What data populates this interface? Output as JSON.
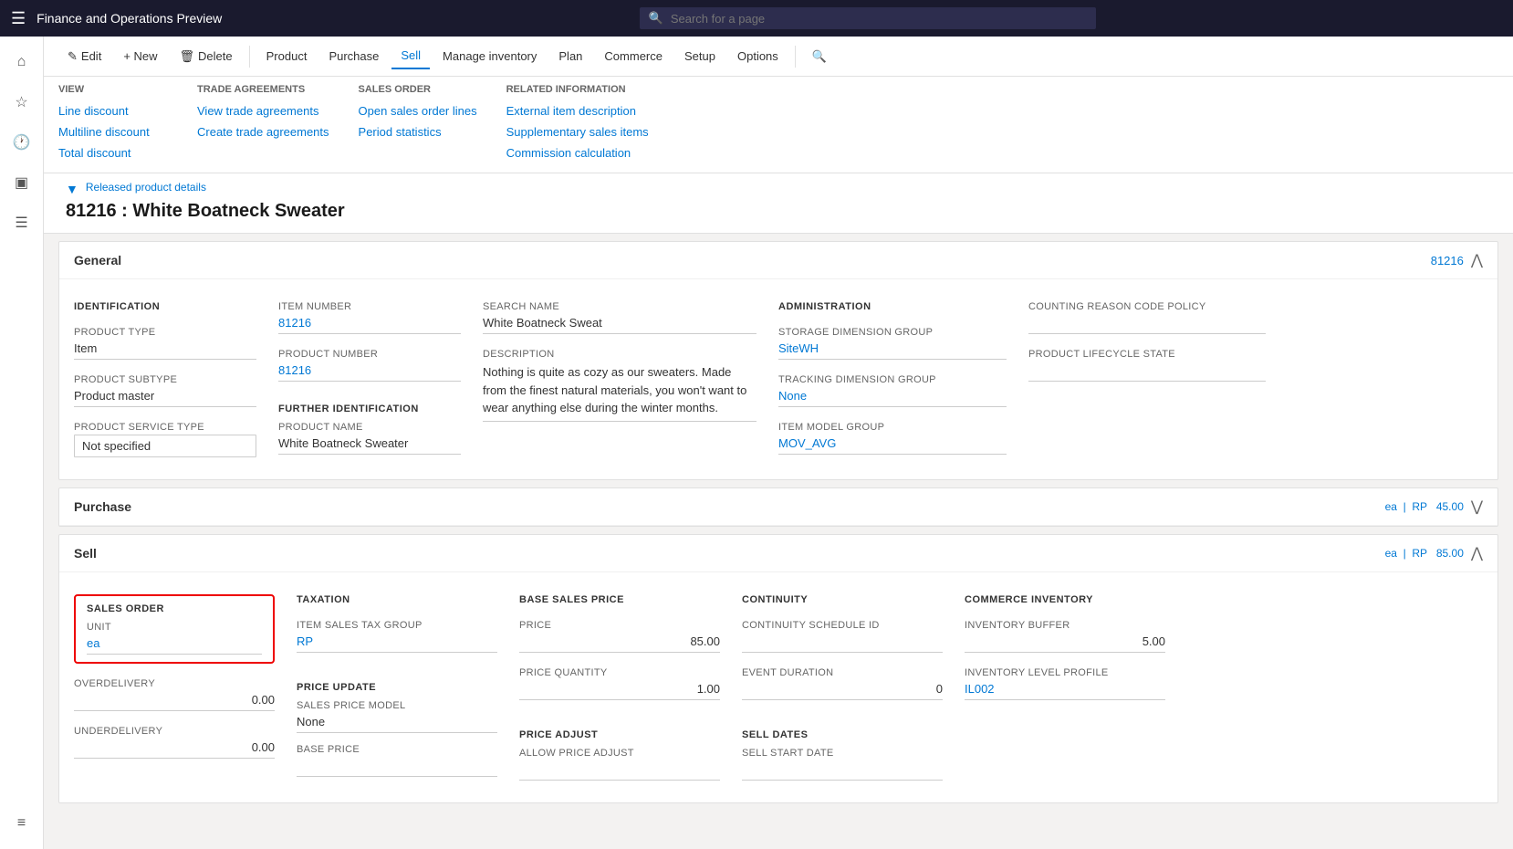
{
  "app": {
    "title": "Finance and Operations Preview",
    "search_placeholder": "Search for a page"
  },
  "sidebar": {
    "icons": [
      {
        "name": "home-icon",
        "symbol": "⌂"
      },
      {
        "name": "star-icon",
        "symbol": "☆"
      },
      {
        "name": "clock-icon",
        "symbol": "🕐"
      },
      {
        "name": "grid-icon",
        "symbol": "⊞"
      },
      {
        "name": "list-icon",
        "symbol": "☰"
      },
      {
        "name": "menu-icon",
        "symbol": "≡"
      }
    ]
  },
  "command_bar": {
    "buttons": [
      {
        "id": "edit",
        "label": "Edit",
        "icon": "✎"
      },
      {
        "id": "new",
        "label": "+ New",
        "icon": ""
      },
      {
        "id": "delete",
        "label": "Delete",
        "icon": "🗑"
      },
      {
        "id": "product",
        "label": "Product"
      },
      {
        "id": "purchase",
        "label": "Purchase"
      },
      {
        "id": "sell",
        "label": "Sell",
        "active": true
      },
      {
        "id": "manage-inventory",
        "label": "Manage inventory"
      },
      {
        "id": "plan",
        "label": "Plan"
      },
      {
        "id": "commerce",
        "label": "Commerce"
      },
      {
        "id": "setup",
        "label": "Setup"
      },
      {
        "id": "options",
        "label": "Options"
      }
    ]
  },
  "dropdown": {
    "groups": [
      {
        "title": "View",
        "links": [
          "Line discount",
          "Multiline discount",
          "Total discount"
        ]
      },
      {
        "title": "Trade agreements",
        "links": [
          "View trade agreements",
          "Create trade agreements"
        ]
      },
      {
        "title": "Sales order",
        "links": [
          "Open sales order lines",
          "Period statistics"
        ]
      },
      {
        "title": "Related information",
        "links": [
          "External item description",
          "Supplementary sales items",
          "Commission calculation"
        ]
      }
    ]
  },
  "page": {
    "breadcrumb": "Released product details",
    "title": "81216 : White Boatneck Sweater"
  },
  "sections": {
    "general": {
      "title": "General",
      "badge": "81216",
      "identification": {
        "label": "IDENTIFICATION",
        "fields": [
          {
            "label": "Product type",
            "value": "Item"
          },
          {
            "label": "Product subtype",
            "value": "Product master"
          },
          {
            "label": "Product service type",
            "value": "Not specified",
            "highlighted": true
          }
        ]
      },
      "item_number": {
        "label": "Item number",
        "value": "81216",
        "link": true
      },
      "product_number": {
        "label": "Product number",
        "value": "81216",
        "link": true
      },
      "further_identification": {
        "label": "FURTHER IDENTIFICATION",
        "product_name_label": "Product name",
        "product_name_value": "White Boatneck Sweater"
      },
      "search_name": {
        "label": "Search name",
        "value": "White Boatneck Sweat"
      },
      "description": {
        "label": "Description",
        "value": "Nothing is quite as cozy as our sweaters. Made from the finest natural materials, you won't want to wear anything else during the winter months."
      },
      "administration": {
        "label": "ADMINISTRATION",
        "fields": [
          {
            "label": "Storage dimension group",
            "value": "SiteWH",
            "link": true
          },
          {
            "label": "Tracking dimension group",
            "value": "None",
            "link": true
          },
          {
            "label": "Item model group",
            "value": "MOV_AVG",
            "link": true
          }
        ]
      },
      "counting": {
        "label": "Counting reason code policy",
        "value": "",
        "lifecycle_label": "Product lifecycle state",
        "lifecycle_value": ""
      }
    },
    "purchase": {
      "title": "Purchase",
      "right_text": "ea  |  RP  45.00",
      "collapsed": true
    },
    "sell": {
      "title": "Sell",
      "right_text": "ea  |  RP  85.00",
      "sales_order": {
        "section_label": "SALES ORDER",
        "unit_label": "Unit",
        "unit_value": "ea",
        "overdelivery_label": "Overdelivery",
        "overdelivery_value": "0.00",
        "underdelivery_label": "Underdelivery",
        "underdelivery_value": "0.00"
      },
      "taxation": {
        "section_label": "TAXATION",
        "item_sales_tax_label": "Item sales tax group",
        "item_sales_tax_value": "RP",
        "price_update_label": "PRICE UPDATE",
        "sales_price_model_label": "Sales price model",
        "sales_price_model_value": "None",
        "base_price_label": "Base price"
      },
      "base_sales_price": {
        "section_label": "BASE SALES PRICE",
        "price_label": "Price",
        "price_value": "85.00",
        "price_quantity_label": "Price quantity",
        "price_quantity_value": "1.00",
        "price_adjust_label": "PRICE ADJUST",
        "allow_price_adjust_label": "Allow price adjust"
      },
      "continuity": {
        "section_label": "CONTINUITY",
        "schedule_id_label": "Continuity schedule ID",
        "schedule_id_value": "",
        "event_duration_label": "Event duration",
        "event_duration_value": "0",
        "sell_dates_label": "SELL DATES",
        "sell_start_date_label": "Sell start date"
      },
      "commerce_inventory": {
        "section_label": "COMMERCE INVENTORY",
        "inventory_buffer_label": "Inventory buffer",
        "inventory_buffer_value": "5.00",
        "inventory_level_label": "Inventory level profile",
        "inventory_level_value": "IL002"
      }
    }
  }
}
